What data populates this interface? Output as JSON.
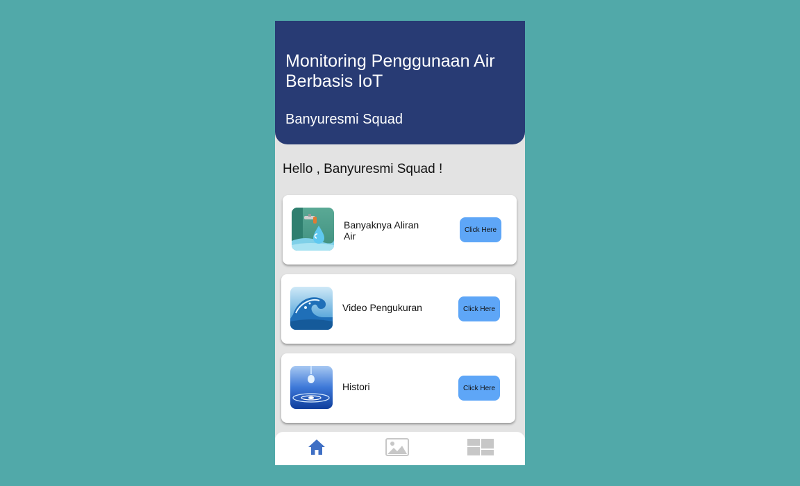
{
  "header": {
    "title": "Monitoring Penggunaan Air Berbasis IoT",
    "subtitle": "Banyuresmi Squad"
  },
  "greeting": "Hello , Banyuresmi Squad !",
  "cards": [
    {
      "label": "Banyaknya Aliran Air",
      "button": "Click Here",
      "icon": "water-faucet-icon"
    },
    {
      "label": "Video Pengukuran",
      "button": "Click Here",
      "icon": "water-wave-icon"
    },
    {
      "label": "Histori",
      "button": "Click Here",
      "icon": "water-drop-icon"
    }
  ],
  "nav": [
    {
      "icon": "home-icon",
      "active": true
    },
    {
      "icon": "image-icon",
      "active": false
    },
    {
      "icon": "dashboard-icon",
      "active": false
    }
  ],
  "colors": {
    "background": "#51a9a9",
    "header": "#283b74",
    "accent_button": "#5ea6f7",
    "nav_active": "#3f6fc4",
    "nav_inactive": "#c7c7c7"
  }
}
